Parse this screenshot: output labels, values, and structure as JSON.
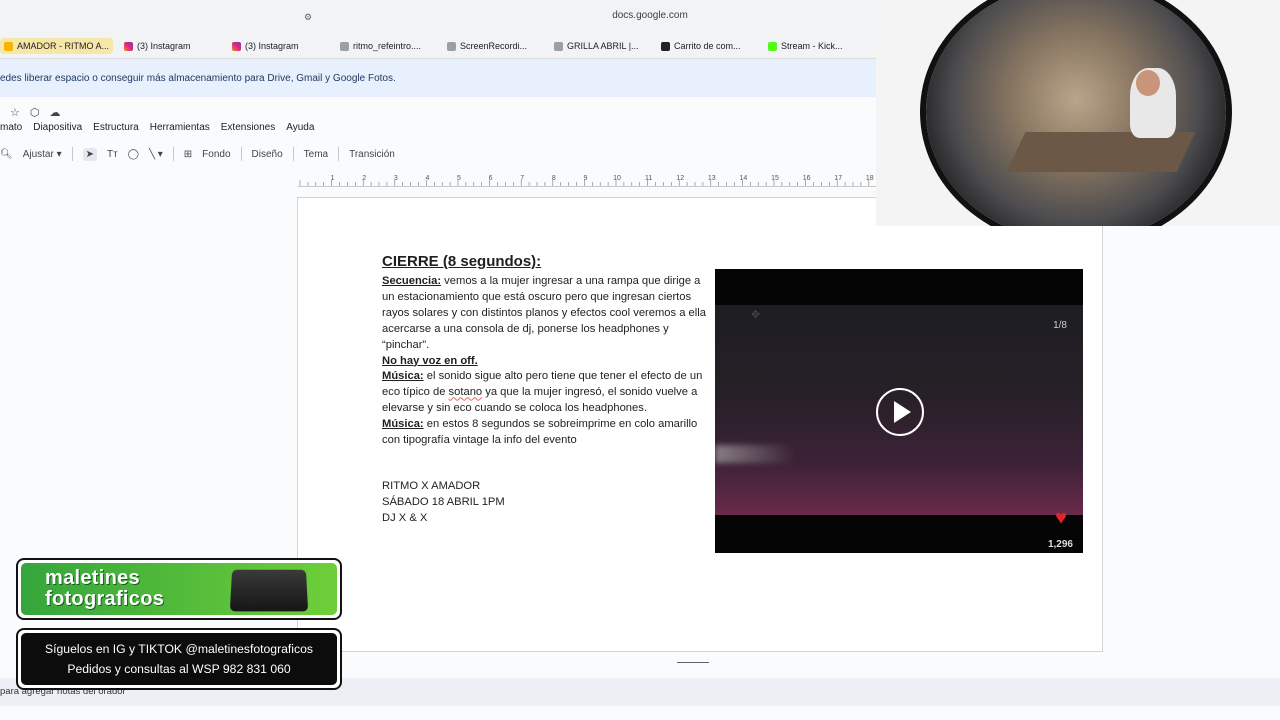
{
  "browser": {
    "url": "docs.google.com",
    "tabs": [
      {
        "label": "AMADOR - RITMO A...",
        "icon": "slides-icon",
        "active": true
      },
      {
        "label": "(3) Instagram",
        "icon": "instagram-icon"
      },
      {
        "label": "(3) Instagram",
        "icon": "instagram-icon"
      },
      {
        "label": "ritmo_refeintro....",
        "icon": "google-icon"
      },
      {
        "label": "ScreenRecordi...",
        "icon": "google-icon"
      },
      {
        "label": "GRILLA ABRIL |...",
        "icon": "google-icon"
      },
      {
        "label": "Carrito de com...",
        "icon": "cart-icon"
      },
      {
        "label": "Stream - Kick...",
        "icon": "kick-icon"
      }
    ]
  },
  "banner": {
    "text": "edes liberar espacio o conseguir más almacenamiento para Drive, Gmail y Google Fotos."
  },
  "quick_icons": [
    "star-icon",
    "drive-move-icon",
    "cloud-icon"
  ],
  "menu": {
    "items": [
      "mato",
      "Diapositiva",
      "Estructura",
      "Herramientas",
      "Extensiones",
      "Ayuda"
    ]
  },
  "toolbar": {
    "zoom_label": "Ajustar",
    "buttons": [
      "Fondo",
      "Diseño",
      "Tema",
      "Transición"
    ]
  },
  "ruler": {
    "labels": [
      "1",
      "2",
      "3",
      "4",
      "5",
      "6",
      "7",
      "8",
      "9",
      "10",
      "11",
      "12",
      "13",
      "14",
      "15",
      "16",
      "17",
      "18"
    ]
  },
  "slide": {
    "title": "CIERRE (8 segundos):",
    "secuencia_label": "Secuencia:",
    "secuencia_text": " vemos a la mujer ingresar a una rampa que dirige a un estacionamiento que está oscuro pero que ingresan ciertos rayos solares y con distintos planos y efectos cool veremos a ella acercarse a una consola de dj, ponerse los headphones y “pinchar”.",
    "no_voz": "No hay voz en off.",
    "musica1_label": "Música:",
    "musica1_text_a": " el sonido sigue alto pero tiene que tener el efecto de un eco típico de ",
    "musica1_word": "sotano",
    "musica1_text_b": " ya que la mujer ingresó, el sonido vuelve a elevarse y sin eco cuando se coloca los headphones.",
    "musica2_label": "Música:",
    "musica2_text": " en estos 8 segundos se sobreimprime en colo amarillo con tipografía vintage la info del evento",
    "event_line1": "RITMO X AMADOR",
    "event_line2": "SÁBADO 18 ABRIL 1PM",
    "event_line3": "DJ X & X"
  },
  "video": {
    "counter": "1/8",
    "likes": "1,296"
  },
  "notes": {
    "placeholder": "para agregar notas del orador"
  },
  "promo": {
    "brand_line1": "maletines",
    "brand_line2": "fotograficos"
  },
  "social": {
    "line1": "Síguelos en IG y TIKTOK @maletinesfotograficos",
    "line2": "Pedidos y consultas al WSP 982 831 060"
  },
  "colors": {
    "accent_blue": "#1a73e8",
    "banner_bg": "#e8f0fe",
    "promo_green": "#4cb83c",
    "heart_red": "#e0242b"
  }
}
